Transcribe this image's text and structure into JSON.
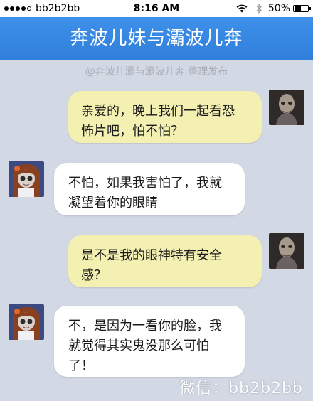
{
  "status_bar": {
    "carrier": "bb2b2bb",
    "time": "8:16 AM",
    "battery_pct": "50%",
    "battery_level": 0.5
  },
  "header": {
    "title": "奔波儿妹与灞波儿奔"
  },
  "watermark_top": "@奔波儿灞与灞波儿奔 整理发布",
  "messages": [
    {
      "side": "out",
      "text_line1": "亲爱的，晚上我们一起看恐",
      "text_line2": "怖片吧，怕不怕？"
    },
    {
      "side": "in",
      "text_line1": "不怕，如果我害怕了，我就",
      "text_line2": "凝望着你的眼睛"
    },
    {
      "side": "out",
      "text_line1": "是不是我的眼神特有安全",
      "text_line2": "感？"
    },
    {
      "side": "in",
      "text_line1": "不，是因为一看你的脸，我",
      "text_line2": "就觉得其实鬼没那么可怕",
      "text_line3": "了！"
    }
  ],
  "watermark_bottom": "微信：bb2b2bb",
  "colors": {
    "header_bg": "#3388e4",
    "chat_bg": "#d3d8e5",
    "outgoing_bubble": "#f3f0b2",
    "incoming_bubble": "#ffffff"
  },
  "icons": {
    "wifi": "wifi-icon",
    "bluetooth": "bluetooth-icon",
    "battery": "battery-icon",
    "signal": "signal-icon"
  }
}
